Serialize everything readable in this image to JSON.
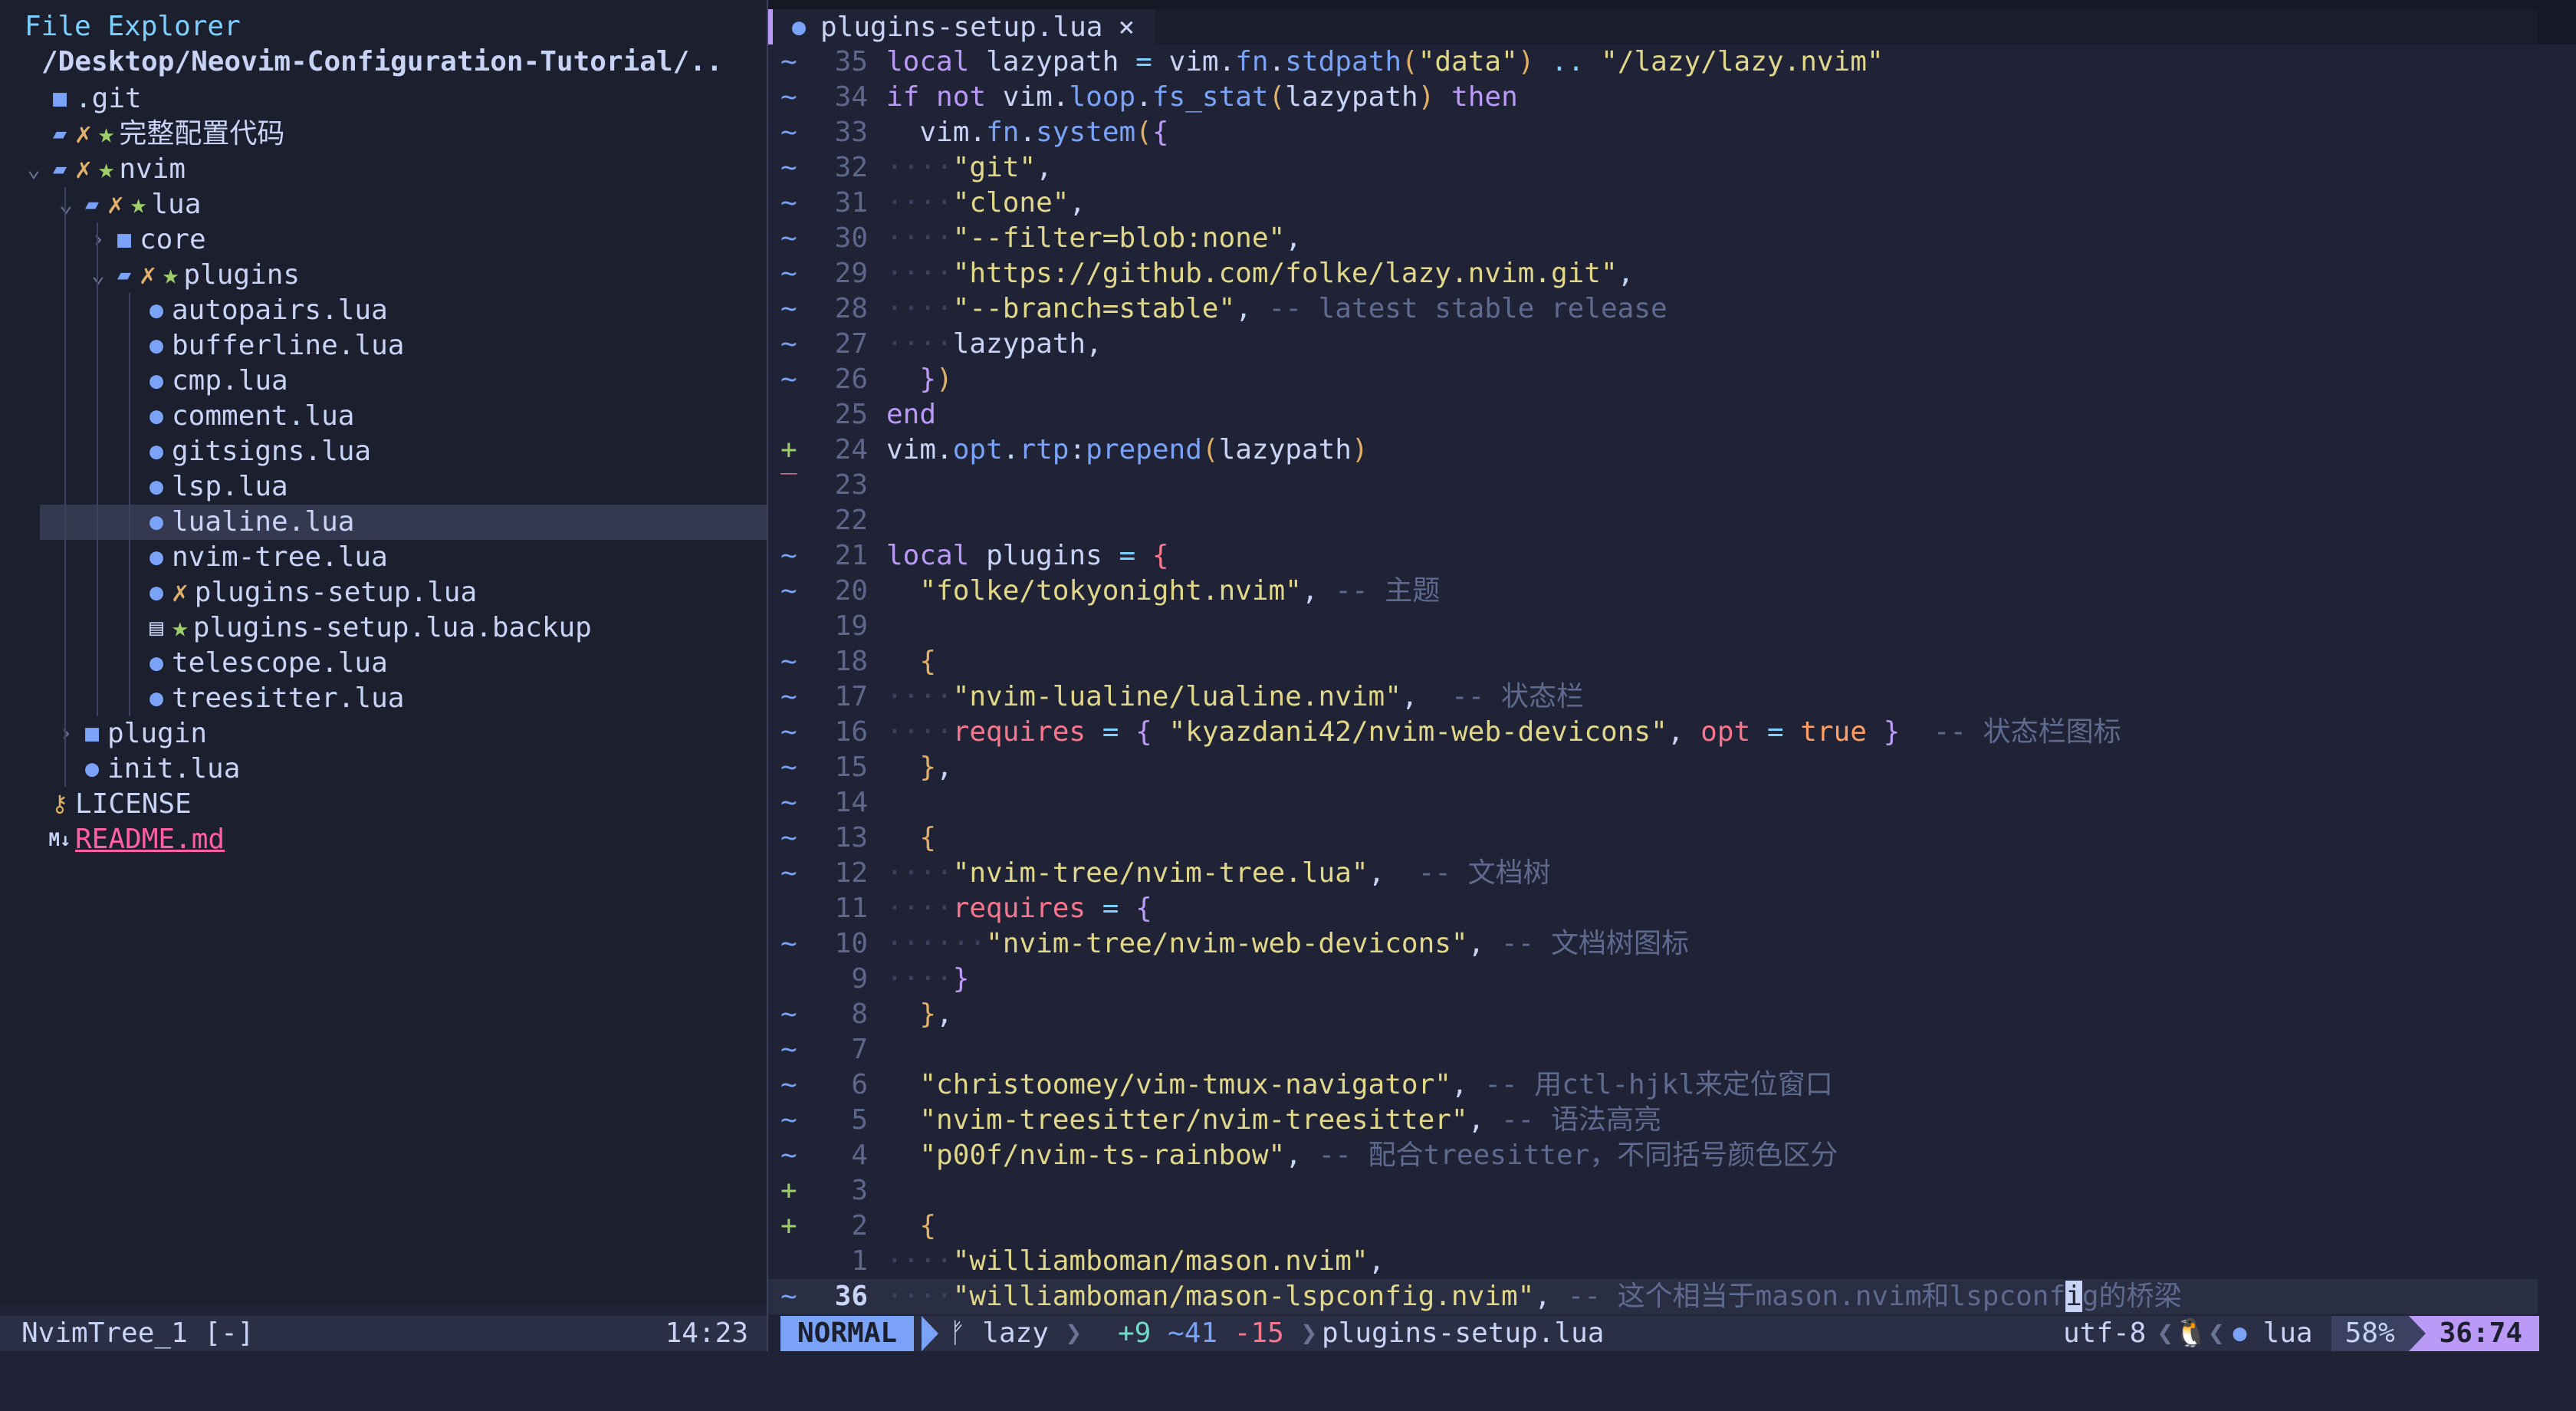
{
  "explorer": {
    "title": "File Explorer",
    "root": "/Desktop/Neovim-Configuration-Tutorial/..",
    "items": [
      {
        "name": ".git",
        "icon": "folder-icon",
        "level": 0,
        "chevron": "",
        "x": false,
        "star": false
      },
      {
        "name": "完整配置代码",
        "icon": "folder-open-icon",
        "level": 0,
        "chevron": "",
        "x": true,
        "star": true
      },
      {
        "name": "nvim",
        "icon": "folder-open-icon",
        "level": 0,
        "chevron": "⌄",
        "x": true,
        "star": true
      },
      {
        "name": "lua",
        "icon": "folder-open-icon",
        "level": 1,
        "chevron": "⌄",
        "x": true,
        "star": true
      },
      {
        "name": "core",
        "icon": "folder-icon",
        "level": 2,
        "chevron": "›",
        "x": false,
        "star": false
      },
      {
        "name": "plugins",
        "icon": "folder-open-icon",
        "level": 2,
        "chevron": "⌄",
        "x": true,
        "star": true
      },
      {
        "name": "autopairs.lua",
        "icon": "lua-icon",
        "level": 3,
        "chevron": "",
        "x": false,
        "star": false
      },
      {
        "name": "bufferline.lua",
        "icon": "lua-icon",
        "level": 3,
        "chevron": "",
        "x": false,
        "star": false
      },
      {
        "name": "cmp.lua",
        "icon": "lua-icon",
        "level": 3,
        "chevron": "",
        "x": false,
        "star": false
      },
      {
        "name": "comment.lua",
        "icon": "lua-icon",
        "level": 3,
        "chevron": "",
        "x": false,
        "star": false
      },
      {
        "name": "gitsigns.lua",
        "icon": "lua-icon",
        "level": 3,
        "chevron": "",
        "x": false,
        "star": false
      },
      {
        "name": "lsp.lua",
        "icon": "lua-icon",
        "level": 3,
        "chevron": "",
        "x": false,
        "star": false
      },
      {
        "name": "lualine.lua",
        "icon": "lua-icon",
        "level": 3,
        "chevron": "",
        "x": false,
        "star": false,
        "selected": true
      },
      {
        "name": "nvim-tree.lua",
        "icon": "lua-icon",
        "level": 3,
        "chevron": "",
        "x": false,
        "star": false
      },
      {
        "name": "plugins-setup.lua",
        "icon": "lua-icon",
        "level": 3,
        "chevron": "",
        "x": true,
        "star": false
      },
      {
        "name": "plugins-setup.lua.backup",
        "icon": "file-icon",
        "level": 3,
        "chevron": "",
        "x": false,
        "star": true
      },
      {
        "name": "telescope.lua",
        "icon": "lua-icon",
        "level": 3,
        "chevron": "",
        "x": false,
        "star": false
      },
      {
        "name": "treesitter.lua",
        "icon": "lua-icon",
        "level": 3,
        "chevron": "",
        "x": false,
        "star": false
      },
      {
        "name": "plugin",
        "icon": "folder-icon",
        "level": 1,
        "chevron": "›",
        "x": false,
        "star": false
      },
      {
        "name": "init.lua",
        "icon": "lua-icon",
        "level": 1,
        "chevron": "",
        "x": false,
        "star": false
      },
      {
        "name": "LICENSE",
        "icon": "license-icon",
        "level": 0,
        "chevron": "",
        "x": false,
        "star": false
      },
      {
        "name": "README.md",
        "icon": "markdown-icon",
        "level": 0,
        "chevron": "",
        "x": false,
        "star": false,
        "md": true
      }
    ],
    "status_left": "NvimTree_1 [-]",
    "status_right": "14:23"
  },
  "tab": {
    "label": "plugins-setup.lua",
    "close": "×"
  },
  "editor": {
    "lines": [
      {
        "sign": "~",
        "num": "35",
        "html": "<span class=\"kw\">local</span> <span class=\"id\">lazypath</span> <span class=\"op\">=</span> <span class=\"id\">vim</span>.<span class=\"fn\">fn</span>.<span class=\"fn\">stdpath</span><span class=\"br\">(</span><span class=\"str\">\"data\"</span><span class=\"br\">)</span> <span class=\"op\">..</span> <span class=\"str\">\"/lazy/lazy.nvim\"</span>"
      },
      {
        "sign": "~",
        "num": "34",
        "html": "<span class=\"kw\">if</span> <span class=\"kw\">not</span> <span class=\"id\">vim</span>.<span class=\"fn\">loop</span>.<span class=\"fn\">fs_stat</span><span class=\"br\">(</span><span class=\"id\">lazypath</span><span class=\"br\">)</span> <span class=\"kw\">then</span>"
      },
      {
        "sign": "~",
        "num": "33",
        "html": "  <span class=\"id\">vim</span>.<span class=\"fn\">fn</span>.<span class=\"fn\">system</span><span class=\"br\">(</span><span class=\"br2\">{</span>"
      },
      {
        "sign": "~",
        "num": "32",
        "html": "<span class=\"ind\">····</span><span class=\"str\">\"git\"</span>,"
      },
      {
        "sign": "~",
        "num": "31",
        "html": "<span class=\"ind\">····</span><span class=\"str\">\"clone\"</span>,"
      },
      {
        "sign": "~",
        "num": "30",
        "html": "<span class=\"ind\">····</span><span class=\"str\">\"--filter=blob:none\"</span>,"
      },
      {
        "sign": "~",
        "num": "29",
        "html": "<span class=\"ind\">····</span><span class=\"str\">\"https://github.com/folke/lazy.nvim.git\"</span>,"
      },
      {
        "sign": "~",
        "num": "28",
        "html": "<span class=\"ind\">····</span><span class=\"str\">\"--branch=stable\"</span>, <span class=\"cm\">-- latest stable release</span>"
      },
      {
        "sign": "~",
        "num": "27",
        "html": "<span class=\"ind\">····</span><span class=\"id\">lazypath</span>,"
      },
      {
        "sign": "~",
        "num": "26",
        "html": "  <span class=\"br2\">}</span><span class=\"br\">)</span>"
      },
      {
        "sign": "",
        "num": "25",
        "html": "<span class=\"kw\">end</span>"
      },
      {
        "sign": "+",
        "num": "24",
        "html": "<span class=\"id\">vim</span>.<span class=\"fn\">opt</span>.<span class=\"fn\">rtp</span>:<span class=\"fn\">prepend</span><span class=\"br\">(</span><span class=\"id\">lazypath</span><span class=\"br\">)</span>"
      },
      {
        "sign": "‾",
        "num": "23",
        "html": ""
      },
      {
        "sign": "",
        "num": "22",
        "html": ""
      },
      {
        "sign": "~",
        "num": "21",
        "html": "<span class=\"kw\">local</span> <span class=\"id\">plugins</span> <span class=\"op\">=</span> <span class=\"kw2\">{</span>"
      },
      {
        "sign": "~",
        "num": "20",
        "html": "  <span class=\"str\">\"folke/tokyonight.nvim\"</span>, <span class=\"cm\">-- 主题</span>"
      },
      {
        "sign": "",
        "num": "19",
        "html": ""
      },
      {
        "sign": "~",
        "num": "18",
        "html": "  <span class=\"br\">{</span>"
      },
      {
        "sign": "~",
        "num": "17",
        "html": "<span class=\"ind\">····</span><span class=\"str\">\"nvim-lualine/lualine.nvim\"</span>,  <span class=\"cm\">-- 状态栏</span>"
      },
      {
        "sign": "~",
        "num": "16",
        "html": "<span class=\"ind\">····</span><span class=\"kw2\">requires</span> <span class=\"op\">=</span> <span class=\"br2\">{</span> <span class=\"str\">\"kyazdani42/nvim-web-devicons\"</span>, <span class=\"kw2\">opt</span> <span class=\"op\">=</span> <span class=\"boolv\">true</span> <span class=\"br2\">}</span>  <span class=\"cm\">-- 状态栏图标</span>"
      },
      {
        "sign": "~",
        "num": "15",
        "html": "  <span class=\"br\">}</span>,"
      },
      {
        "sign": "~",
        "num": "14",
        "html": ""
      },
      {
        "sign": "~",
        "num": "13",
        "html": "  <span class=\"br\">{</span>"
      },
      {
        "sign": "~",
        "num": "12",
        "html": "<span class=\"ind\">····</span><span class=\"str\">\"nvim-tree/nvim-tree.lua\"</span>,  <span class=\"cm\">-- 文档树</span>"
      },
      {
        "sign": "",
        "num": "11",
        "html": "<span class=\"ind\">····</span><span class=\"kw2\">requires</span> <span class=\"op\">=</span> <span class=\"br2\">{</span>"
      },
      {
        "sign": "~",
        "num": "10",
        "html": "<span class=\"ind\">······</span><span class=\"str\">\"nvim-tree/nvim-web-devicons\"</span>, <span class=\"cm\">-- 文档树图标</span>"
      },
      {
        "sign": "",
        "num": "9",
        "html": "<span class=\"ind\">····</span><span class=\"br2\">}</span>"
      },
      {
        "sign": "~",
        "num": "8",
        "html": "  <span class=\"br\">}</span>,"
      },
      {
        "sign": "~",
        "num": "7",
        "html": ""
      },
      {
        "sign": "~",
        "num": "6",
        "html": "  <span class=\"str\">\"christoomey/vim-tmux-navigator\"</span>, <span class=\"cm\">-- 用ctl-hjkl来定位窗口</span>"
      },
      {
        "sign": "~",
        "num": "5",
        "html": "  <span class=\"str\">\"nvim-treesitter/nvim-treesitter\"</span>, <span class=\"cm\">-- 语法高亮</span>"
      },
      {
        "sign": "~",
        "num": "4",
        "html": "  <span class=\"str\">\"p00f/nvim-ts-rainbow\"</span>, <span class=\"cm\">-- 配合treesitter，不同括号颜色区分</span>"
      },
      {
        "sign": "+",
        "num": "3",
        "html": ""
      },
      {
        "sign": "+",
        "num": "2",
        "html": "  <span class=\"br\">{</span>"
      },
      {
        "sign": "",
        "num": "1",
        "html": "<span class=\"ind\">····</span><span class=\"str\">\"williamboman/mason.nvim\"</span>,"
      },
      {
        "sign": "~",
        "num": "36",
        "cur": true,
        "html": "<span class=\"ind\">····</span><span class=\"str\">\"williamboman/mason-lspconfig.nvim\"</span>, <span class=\"cm\">-- 这个相当于mason.nvim和lspconf</span><span class=\"cursor\">i</span><span class=\"cm\">g的桥梁</span>"
      }
    ]
  },
  "status": {
    "mode": "NORMAL",
    "branch": "lazy",
    "diff_add": "+9",
    "diff_mod": "~41",
    "diff_del": "-15",
    "file": "plugins-setup.lua",
    "encoding": "utf-8",
    "filetype": "lua",
    "percent": "58%",
    "position": "36:74"
  },
  "colors": {
    "accent": "#7aa2f7",
    "mode_bg": "#7aa2f7",
    "position_bg": "#bb9af7",
    "background": "#1f2335"
  }
}
